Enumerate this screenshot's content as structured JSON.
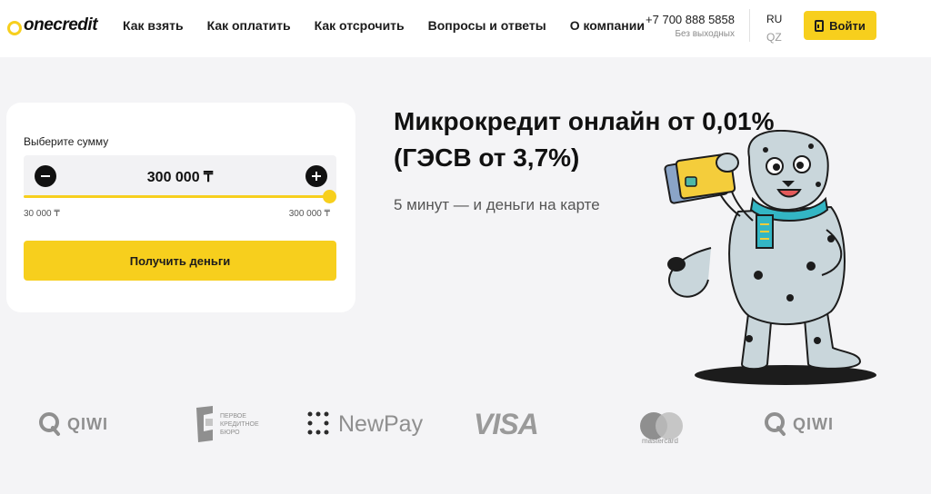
{
  "header": {
    "logo_text": "onecredit",
    "nav": [
      "Как взять",
      "Как оплатить",
      "Как отсрочить",
      "Вопросы и ответы",
      "О компании"
    ],
    "phone": "+7 700 888 5858",
    "phone_note": "Без выходных",
    "languages": [
      "RU",
      "QZ"
    ],
    "active_language": "RU",
    "login_label": "Войти"
  },
  "loan_card": {
    "label": "Выберите сумму",
    "amount": "300 000 ₸",
    "min": "30 000 ₸",
    "max": "300 000 ₸",
    "slider_fraction": 1.0,
    "submit_label": "Получить деньги"
  },
  "hero": {
    "title": "Микрокредит онлайн от 0,01% (ГЭСВ от 3,7%)",
    "subtitle": "5 минут — и деньги на карте"
  },
  "partners": {
    "qiwi_1": "QIWI",
    "pkb": "Первое кредитное бюро",
    "newpay": "NewPay",
    "visa": "VISA",
    "mastercard": "mastercard",
    "qiwi_2": "QIWI"
  },
  "colors": {
    "accent": "#f7cf1d",
    "page_bg": "#f4f4f6",
    "text": "#1c1c1c",
    "partner_gray": "#8f8f8f"
  },
  "icons": [
    "logo-ring-icon",
    "door-icon",
    "minus-icon",
    "plus-icon",
    "snow-leopard-mascot",
    "qiwi-icon",
    "pkb-icon",
    "newpay-dots-icon",
    "mastercard-circles-icon"
  ]
}
